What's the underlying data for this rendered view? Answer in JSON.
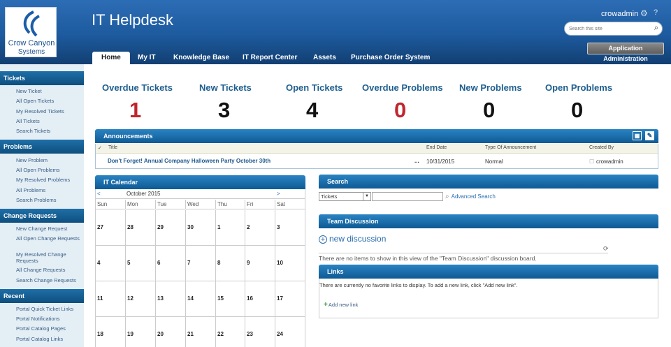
{
  "header": {
    "logo_line1": "Crow Canyon",
    "logo_line2": "Systems",
    "site_title": "IT Helpdesk",
    "user": "crowadmin",
    "search_placeholder": "Search this site",
    "app_admin_label": "Application Administration",
    "nav": [
      {
        "label": "Home",
        "active": true
      },
      {
        "label": "My IT"
      },
      {
        "label": "Knowledge Base"
      },
      {
        "label": "IT Report Center"
      },
      {
        "label": "Assets"
      },
      {
        "label": "Purchase Order System"
      }
    ]
  },
  "sidebar": {
    "sections": [
      {
        "title": "Tickets",
        "items": [
          "New Ticket",
          "All Open Tickets",
          "My Resolved Tickets",
          "All Tickets",
          "Search Tickets"
        ]
      },
      {
        "title": "Problems",
        "items": [
          "New Problem",
          "All Open Problems",
          "My Resolved Problems",
          "All Problems",
          "Search Problems"
        ]
      },
      {
        "title": "Change Requests",
        "items": [
          "New Change Request",
          "All Open Change Requests",
          "My Resolved Change Requests",
          "All Change Requests",
          "Search Change Requests"
        ]
      },
      {
        "title": "Recent",
        "items": [
          "Portal Quick Ticket Links",
          "Portal Notifications",
          "Portal Catalog Pages",
          "Portal Catalog Links"
        ]
      }
    ]
  },
  "stats": [
    {
      "label": "Overdue Tickets",
      "value": "1",
      "color": "#c0272d"
    },
    {
      "label": "New Tickets",
      "value": "3",
      "color": "#111111"
    },
    {
      "label": "Open Tickets",
      "value": "4",
      "color": "#111111"
    },
    {
      "label": "Overdue Problems",
      "value": "0",
      "color": "#c0272d"
    },
    {
      "label": "New Problems",
      "value": "0",
      "color": "#111111"
    },
    {
      "label": "Open Problems",
      "value": "0",
      "color": "#111111"
    }
  ],
  "announcements": {
    "title": "Announcements",
    "columns": {
      "title": "Title",
      "end_date": "End Date",
      "type": "Type Of Announcement",
      "created_by": "Created By"
    },
    "rows": [
      {
        "title": "Don't Forget! Annual Company Halloween Party October 30th",
        "ellipsis": "...",
        "end_date": "10/31/2015",
        "type": "Normal",
        "created_by": "crowadmin"
      }
    ]
  },
  "calendar": {
    "title": "IT Calendar",
    "prev": "<",
    "next": ">",
    "month": "October 2015",
    "days_of_week": [
      "Sun",
      "Mon",
      "Tue",
      "Wed",
      "Thu",
      "Fri",
      "Sat"
    ],
    "weeks": [
      [
        "27",
        "28",
        "29",
        "30",
        "1",
        "2",
        "3"
      ],
      [
        "4",
        "5",
        "6",
        "7",
        "8",
        "9",
        "10"
      ],
      [
        "11",
        "12",
        "13",
        "14",
        "15",
        "16",
        "17"
      ],
      [
        "18",
        "19",
        "20",
        "21",
        "22",
        "23",
        "24"
      ]
    ]
  },
  "search": {
    "title": "Search",
    "scope": "Tickets",
    "query": "",
    "advanced_label": "Advanced Search"
  },
  "team_discussion": {
    "title": "Team Discussion",
    "new_label": "new discussion",
    "empty_message": "There are no items to show in this view of the \"Team Discussion\" discussion board."
  },
  "links": {
    "title": "Links",
    "empty_message": "There are currently no favorite links to display. To add a new link, click \"Add new link\".",
    "add_label": "Add new link"
  }
}
